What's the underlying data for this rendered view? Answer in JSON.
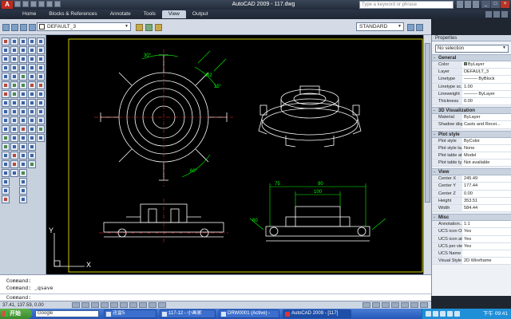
{
  "window": {
    "title": "AutoCAD 2009 - 117.dwg",
    "search_placeholder": "Type a keyword or phrase",
    "controls": [
      "_",
      "□",
      "×"
    ]
  },
  "ribbon": {
    "tabs": [
      {
        "label": "Home",
        "active": false
      },
      {
        "label": "Blocks & References",
        "active": false
      },
      {
        "label": "Annotate",
        "active": false
      },
      {
        "label": "Tools",
        "active": false
      },
      {
        "label": "View",
        "active": true
      },
      {
        "label": "Output",
        "active": false
      }
    ]
  },
  "layer_toolbar": {
    "layer_combo": "DEFAULT_3",
    "text_style": "STANDARD"
  },
  "drawing": {
    "dimensions": [
      "30°",
      "R2",
      "15°",
      "60°",
      "75",
      "90",
      "100",
      "60"
    ],
    "ucs_x": "X",
    "ucs_y": "Y",
    "background": "#000000",
    "line_color": "#ffffff",
    "dim_color": "#00ff00",
    "frame_color": "#ffff00"
  },
  "properties": {
    "title": "Properties",
    "selection": "No selection",
    "sections": [
      {
        "name": "General",
        "rows": [
          {
            "name": "Color",
            "value": "ByLayer",
            "swatch": "#3aa63a"
          },
          {
            "name": "Layer",
            "value": "DEFAULT_3"
          },
          {
            "name": "Linetype",
            "value": "——— ByBlock"
          },
          {
            "name": "Linetype sc...",
            "value": "1.00"
          },
          {
            "name": "Lineweight",
            "value": "——— ByLayer"
          },
          {
            "name": "Thickness",
            "value": "0.00"
          }
        ]
      },
      {
        "name": "3D Visualization",
        "rows": [
          {
            "name": "Material",
            "value": "ByLayer"
          },
          {
            "name": "Shadow disp...",
            "value": "Casts and Recei..."
          }
        ]
      },
      {
        "name": "Plot style",
        "rows": [
          {
            "name": "Plot style",
            "value": "ByColor"
          },
          {
            "name": "Plot style ta...",
            "value": "None"
          },
          {
            "name": "Plot table at...",
            "value": "Model"
          },
          {
            "name": "Plot table ty...",
            "value": "Not available"
          }
        ]
      },
      {
        "name": "View",
        "rows": [
          {
            "name": "Center X",
            "value": "245.49"
          },
          {
            "name": "Center Y",
            "value": "177.44"
          },
          {
            "name": "Center Z",
            "value": "0.00"
          },
          {
            "name": "Height",
            "value": "353.51"
          },
          {
            "name": "Width",
            "value": "584.44"
          }
        ]
      },
      {
        "name": "Misc",
        "rows": [
          {
            "name": "Annotation...",
            "value": "1:1"
          },
          {
            "name": "UCS icon On",
            "value": "Yes"
          },
          {
            "name": "UCS icon at...",
            "value": "Yes"
          },
          {
            "name": "UCS per vie...",
            "value": "Yes"
          },
          {
            "name": "UCS Name",
            "value": ""
          },
          {
            "name": "Visual Style",
            "value": "2D Wireframe"
          }
        ]
      }
    ]
  },
  "command": {
    "history": [
      "Command:",
      "Command: _qsave"
    ],
    "prompt": "Command:"
  },
  "status": {
    "coords": "37.41, 137.59, 0.00"
  },
  "taskbar": {
    "start_label": "开始",
    "google_label": "Google",
    "tasks": [
      {
        "label": "迅雷5",
        "active": false
      },
      {
        "label": "117-12 - 小画家",
        "active": false
      },
      {
        "label": "DRW0001 (Active) -",
        "active": false
      },
      {
        "label": "AutoCAD 2009 - [117]",
        "active": true
      }
    ],
    "clock": "下午 09:41"
  }
}
